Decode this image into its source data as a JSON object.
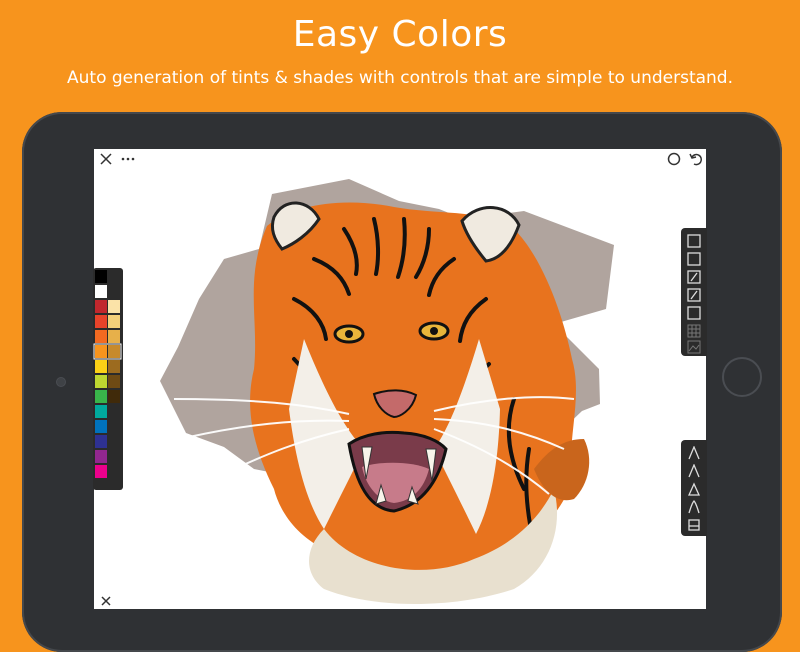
{
  "promo": {
    "headline": "Easy Colors",
    "subline": "Auto generation of tints & shades with controls that are simple to understand."
  },
  "colors": {
    "background": "#F7941D",
    "device_frame": "#2f3134",
    "canvas": "#ffffff",
    "toolbar": "#2b2b2b"
  },
  "top_bar": {
    "left_icons": [
      "close-icon",
      "more-dots-icon"
    ],
    "right_icons": [
      "compare-icon",
      "undo-icon"
    ]
  },
  "palette": {
    "swatches": [
      {
        "left": "#000000",
        "right": null
      },
      {
        "left": "#ffffff",
        "right": null
      },
      {
        "left": "#c1272d",
        "right": "#fbe3a8"
      },
      {
        "left": "#e8432a",
        "right": "#f4d07a"
      },
      {
        "left": "#f26a21",
        "right": "#e7b04a"
      },
      {
        "left": "#f7941d",
        "right": "#c78a2c"
      },
      {
        "left": "#fcd116",
        "right": "#9c6b1f"
      },
      {
        "left": "#bfd730",
        "right": "#6e4a14"
      },
      {
        "left": "#39b54a",
        "right": "#402a0a"
      },
      {
        "left": "#00a99d",
        "right": null
      },
      {
        "left": "#0072bc",
        "right": null
      },
      {
        "left": "#2e3192",
        "right": null
      },
      {
        "left": "#92278f",
        "right": null
      },
      {
        "left": "#ec008c",
        "right": null
      }
    ],
    "selected_index": 5
  },
  "toolbar": {
    "tools": [
      "layer-icon",
      "layer-icon",
      "brush-icon",
      "brush-icon",
      "layer-icon",
      "grid-icon",
      "image-icon"
    ],
    "brush_tools": [
      "pencil-icon",
      "pen-icon",
      "marker-icon",
      "brush-icon",
      "eraser-icon"
    ]
  }
}
